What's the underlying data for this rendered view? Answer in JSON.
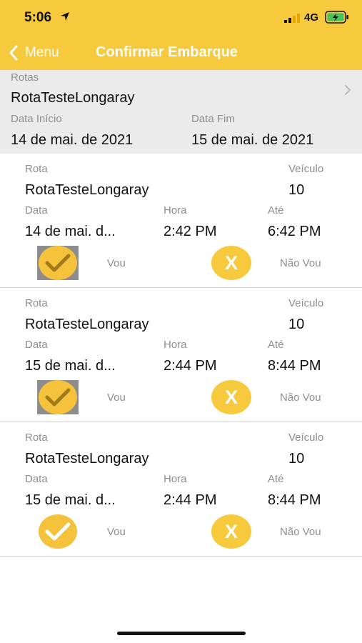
{
  "status_bar": {
    "time": "5:06",
    "network": "4G"
  },
  "nav": {
    "back_label": "Menu",
    "title": "Confirmar Embarque"
  },
  "filter": {
    "rotas_label": "Rotas",
    "rota_value": "RotaTesteLongaray",
    "data_inicio_label": "Data Início",
    "data_inicio_value": "14 de mai. de 2021",
    "data_fim_label": "Data Fim",
    "data_fim_value": "15 de mai. de 2021"
  },
  "labels": {
    "rota": "Rota",
    "veiculo": "Veículo",
    "data": "Data",
    "hora": "Hora",
    "ate": "Até",
    "vou": "Vou",
    "nao_vou": "Não Vou",
    "x_symbol": "X"
  },
  "trips": [
    {
      "rota": "RotaTesteLongaray",
      "veiculo": "10",
      "data": "14 de mai. d...",
      "hora": "2:42 PM",
      "ate": "6:42 PM"
    },
    {
      "rota": "RotaTesteLongaray",
      "veiculo": "10",
      "data": "15 de mai. d...",
      "hora": "2:44 PM",
      "ate": "8:44 PM"
    },
    {
      "rota": "RotaTesteLongaray",
      "veiculo": "10",
      "data": "15 de mai. d...",
      "hora": "2:44 PM",
      "ate": "8:44 PM"
    }
  ],
  "colors": {
    "accent": "#f7c93c",
    "check": "#f5c23c",
    "selected_bg": "#8d8d8d",
    "filter_bg": "#ebebeb",
    "label_gray": "#8e8e8e"
  },
  "icons": {
    "back": "chevron-left-icon",
    "forward": "chevron-right-icon",
    "check": "checkmark-icon",
    "location": "location-arrow-icon",
    "signal": "signal-icon",
    "battery": "battery-charging-icon"
  }
}
